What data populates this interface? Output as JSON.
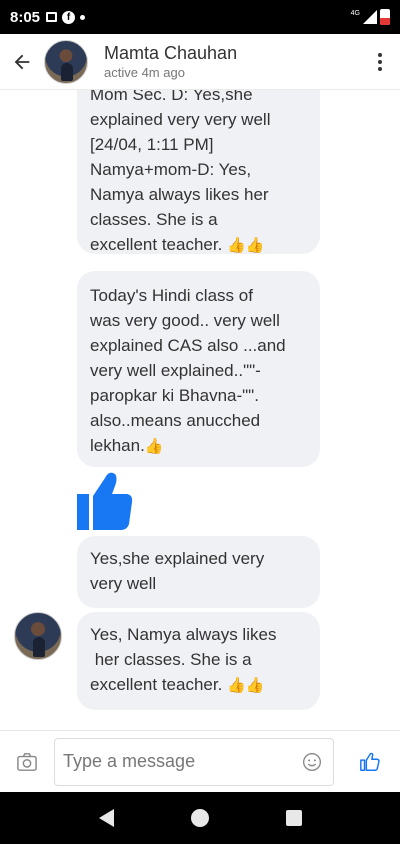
{
  "status_bar": {
    "time": "8:05",
    "network": "4G"
  },
  "header": {
    "contact_name": "Mamta Chauhan",
    "contact_status": "active 4m ago"
  },
  "messages": [
    {
      "lines": [
        "Mom Sec. D: Yes,she",
        "explained very very well",
        "[24/04, 1:11 PM]",
        "Namya+mom-D: Yes,",
        "Namya always likes her",
        "classes. She is a",
        "excellent teacher."
      ],
      "emoji": "👍👍"
    },
    {
      "lines": [
        "Today's Hindi class of",
        "was very good.. very well",
        "explained CAS also ...and",
        "very well explained..\"\"-",
        "paropkar ki Bhavna-\"\".",
        "also..means anucched",
        "lekhan."
      ],
      "emoji": "👍"
    },
    {
      "lines": [
        "Yes,she explained very",
        "very well"
      ],
      "emoji": ""
    },
    {
      "lines": [
        "Yes, Namya always likes",
        " her classes. She is a",
        "excellent teacher."
      ],
      "emoji": "👍👍"
    }
  ],
  "composer": {
    "placeholder": "Type a message"
  },
  "colors": {
    "accent": "#1877f2",
    "bubble": "#f0f1f5",
    "text": "#333333"
  },
  "icons": [
    "back-arrow-icon",
    "more-options-icon",
    "camera-icon",
    "emoji-icon",
    "like-icon",
    "thumbs-up-sticker"
  ]
}
